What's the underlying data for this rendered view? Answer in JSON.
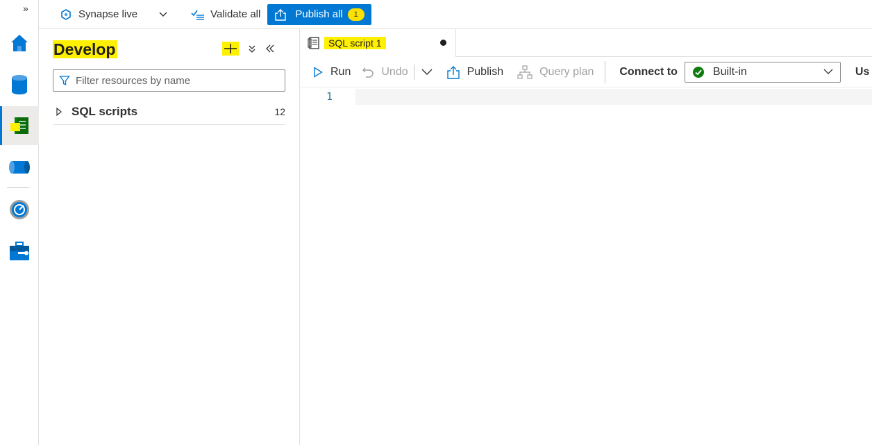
{
  "rail": {
    "expand_glyph": "»",
    "items": [
      {
        "name": "home-icon"
      },
      {
        "name": "data-icon"
      },
      {
        "name": "develop-icon",
        "active": true
      },
      {
        "name": "integrate-icon"
      },
      {
        "name": "monitor-icon"
      },
      {
        "name": "manage-icon"
      }
    ]
  },
  "topbar": {
    "mode_label": "Synapse live",
    "validate_label": "Validate all",
    "publish_label": "Publish all",
    "publish_badge": "1"
  },
  "develop": {
    "title": "Develop",
    "filter_placeholder": "Filter resources by name",
    "tree": [
      {
        "label": "SQL scripts",
        "count": "12"
      }
    ]
  },
  "editor": {
    "tab_label": "SQL script 1",
    "toolbar": {
      "run": "Run",
      "undo": "Undo",
      "publish": "Publish",
      "query_plan": "Query plan",
      "connect_to": "Connect to",
      "connect_value": "Built-in",
      "use_label": "Us"
    },
    "line_number": "1"
  },
  "colors": {
    "accent": "#0078d4",
    "highlight": "#fff000",
    "success": "#107c10"
  }
}
